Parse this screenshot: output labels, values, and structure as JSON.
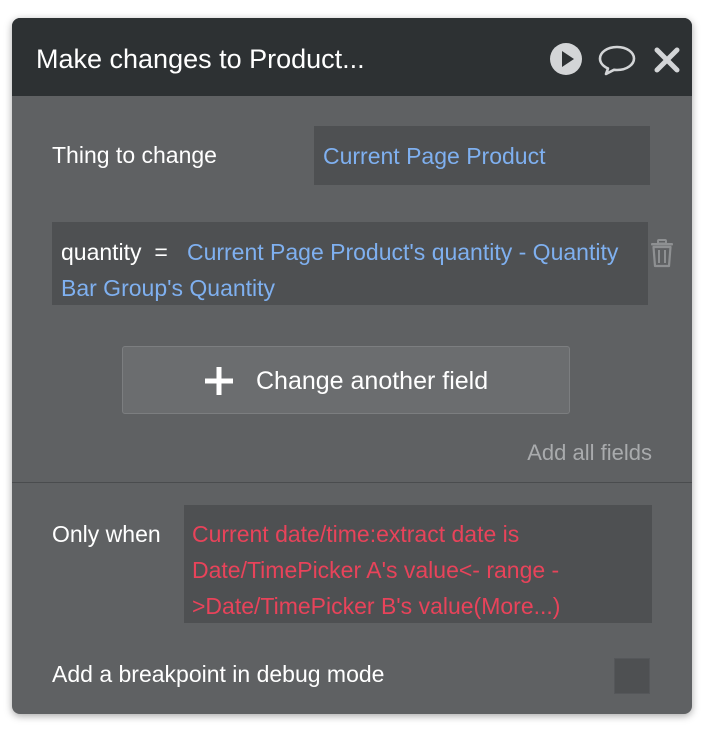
{
  "header": {
    "title": "Make changes to Product...",
    "icons": [
      "play-icon",
      "comment-icon",
      "close-icon"
    ]
  },
  "thing": {
    "label": "Thing to change",
    "value": "Current Page Product"
  },
  "field_change": {
    "field": "quantity",
    "operator": "=",
    "expression": "Current Page Product's quantity - Quantity Bar Group's Quantity"
  },
  "actions": {
    "change_another_field": "Change another field",
    "add_all_fields": "Add all fields"
  },
  "condition": {
    "label": "Only when",
    "expression": "Current date/time:extract date is Date/TimePicker A's value<- range ->Date/TimePicker B's value(More...)"
  },
  "breakpoint": {
    "label": "Add a breakpoint in debug mode",
    "checked": false
  },
  "colors": {
    "header_bg": "#2d3133",
    "panel_bg": "#5f6163",
    "input_bg": "#4e5052",
    "link_blue": "#7fb0f0",
    "condition_red": "#e8435a"
  }
}
